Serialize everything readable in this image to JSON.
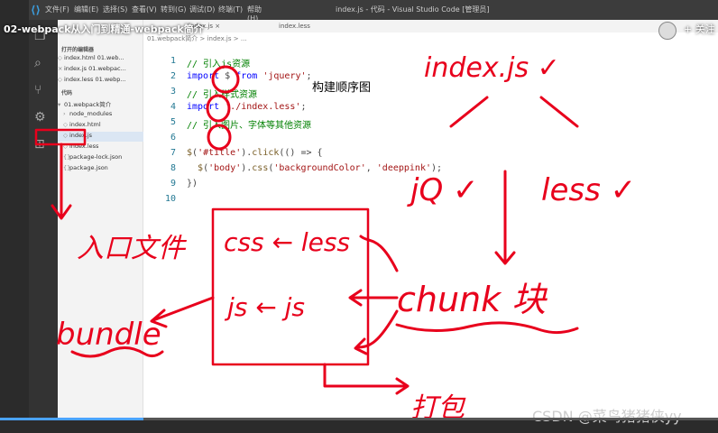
{
  "video": {
    "title": "02-webpack从入门到精通-webpack简介",
    "close_label": "+ 关注",
    "progress": 0.2
  },
  "vscode": {
    "window_title": "index.js - 代码 - Visual Studio Code [管理员]",
    "menu": [
      "文件(F)",
      "编辑(E)",
      "选择(S)",
      "查看(V)",
      "转到(G)",
      "调试(D)",
      "终端(T)",
      "帮助(H)"
    ],
    "tabs": [
      "index.js ×",
      "index.less"
    ],
    "explorer": {
      "open_editors_header": "打开的编辑器",
      "open_editors": [
        "index.html 01.web...",
        "index.js 01.webpac...",
        "index.less 01.webp..."
      ],
      "folder_header": "代码",
      "project": "01.webpack简介",
      "files": [
        "node_modules",
        "index.html",
        "index.js",
        "index.less",
        "package-lock.json",
        "package.json"
      ]
    },
    "breadcrumb": "01.webpack简介 > index.js > ...",
    "line_numbers": [
      "1",
      "2",
      "3",
      "4",
      "5",
      "6",
      "7",
      "8",
      "9",
      "10"
    ]
  },
  "annotations": {
    "title_text": "构建顺序图",
    "handwriting": [
      "index.js ✓",
      "jQ ✓",
      "less ✓",
      "入口文件",
      "bundle",
      "css ← less",
      "js ← js",
      "chunk 块",
      "打包"
    ],
    "watermark": "CSDN @菜鸟猪猪侠yy"
  },
  "colors": {
    "ink": "#e8001c",
    "accent": "#3b9ddd"
  }
}
